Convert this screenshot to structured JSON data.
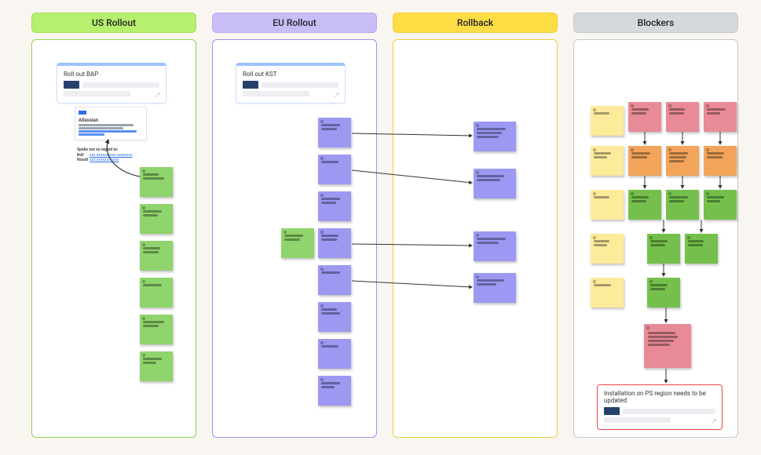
{
  "columns": {
    "us": {
      "title": "US Rollout"
    },
    "eu": {
      "title": "EU Rollout"
    },
    "rollback": {
      "title": "Rollback"
    },
    "blockers": {
      "title": "Blockers"
    }
  },
  "cards": {
    "bap": {
      "title": "Roll out BAP"
    },
    "kst": {
      "title": "Roll out KST"
    },
    "update": {
      "title": "Installation on PS region needs to be updated"
    }
  },
  "info": {
    "atlassian": {
      "title": "Atlassian"
    }
  },
  "comment": {
    "heading": "Spoke xxx xx regard to:",
    "row1_label": "Roll",
    "row2_label": "Result"
  }
}
